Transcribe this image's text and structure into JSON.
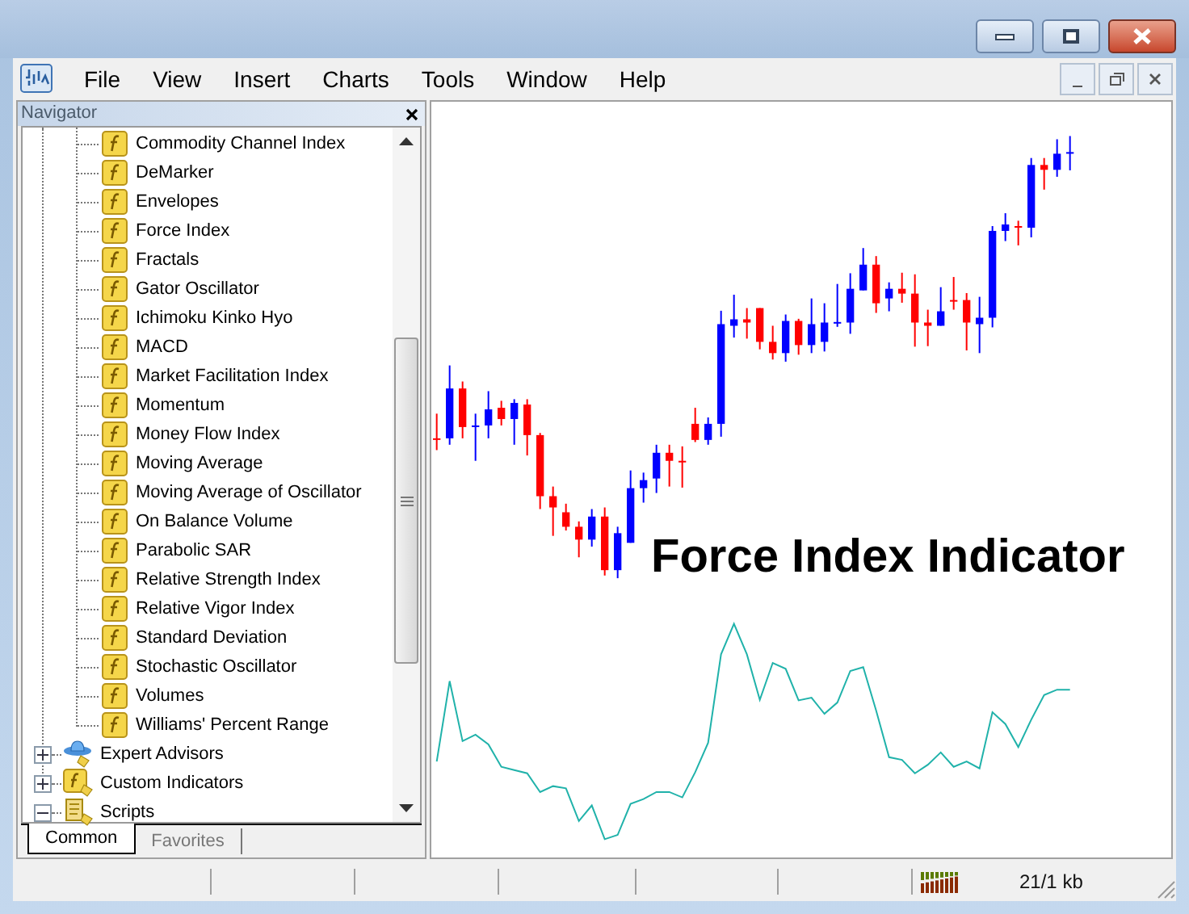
{
  "menu": [
    "File",
    "View",
    "Insert",
    "Charts",
    "Tools",
    "Window",
    "Help"
  ],
  "navigator": {
    "title": "Navigator",
    "indicators": [
      "Commodity Channel Index",
      "DeMarker",
      "Envelopes",
      "Force Index",
      "Fractals",
      "Gator Oscillator",
      "Ichimoku Kinko Hyo",
      "MACD",
      "Market Facilitation Index",
      "Momentum",
      "Money Flow Index",
      "Moving Average",
      "Moving Average of Oscillator",
      "On Balance Volume",
      "Parabolic SAR",
      "Relative Strength Index",
      "Relative Vigor Index",
      "Standard Deviation",
      "Stochastic Oscillator",
      "Volumes",
      "Williams' Percent Range"
    ],
    "folders": [
      {
        "label": "Expert Advisors",
        "kind": "experts",
        "expanded": false
      },
      {
        "label": "Custom Indicators",
        "kind": "custom",
        "expanded": false
      },
      {
        "label": "Scripts",
        "kind": "scripts",
        "expanded": true
      }
    ],
    "tabs": [
      {
        "label": "Common",
        "selected": true
      },
      {
        "label": "Favorites",
        "selected": false
      }
    ]
  },
  "chart": {
    "caption": "Force Index Indicator"
  },
  "status_bar": {
    "traffic": "21/1 kb"
  }
}
